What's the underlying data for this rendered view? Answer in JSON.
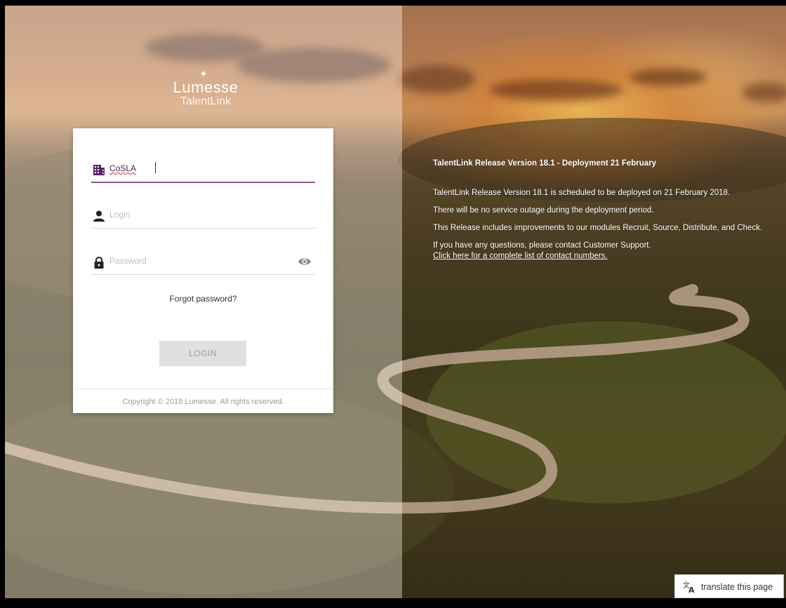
{
  "brand": {
    "logo_name": "Lumesse",
    "logo_sub": "TalentLink"
  },
  "login_form": {
    "tenant_value": "CoSLA",
    "login_placeholder": "Login",
    "password_placeholder": "Password",
    "forgot_password": "Forgot password?",
    "login_button": "LOGIN",
    "copyright": "Copyright © 2018 Lumesse. All rights reserved."
  },
  "announcement": {
    "title": "TalentLink Release Version 18.1 - Deployment 21 February",
    "paragraphs": [
      "TalentLink Release Version 18.1 is scheduled to be deployed on 21 February 2018.",
      "There will be no service outage during the deployment period.",
      "This Release includes improvements to our modules Recruit, Source, Distribute, and Check."
    ],
    "contact_text": "If you have any questions, please contact Customer Support.",
    "contact_link": "Click here for a complete list of contact numbers."
  },
  "translate": {
    "label": "translate this page"
  },
  "icons": {
    "tenant": "building-icon",
    "login": "user-icon",
    "password": "lock-icon",
    "show_password": "eye-icon",
    "translate": "translate-icon"
  },
  "colors": {
    "accent": "#8a5b86",
    "tenant_text": "#4b1e53",
    "button_bg": "#e0e0e0"
  }
}
